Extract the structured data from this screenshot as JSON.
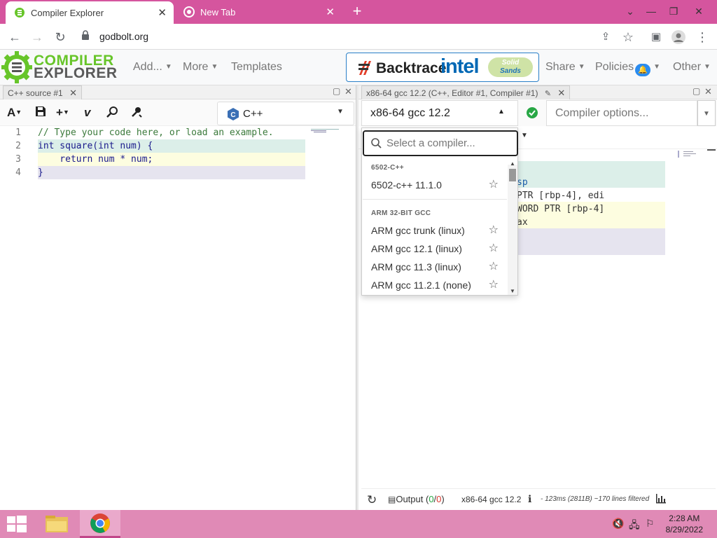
{
  "browser": {
    "tabs": [
      {
        "label": "Compiler Explorer",
        "icon": "compiler-explorer-favicon"
      },
      {
        "label": "New Tab",
        "icon": "chrome-icon"
      }
    ],
    "address": "godbolt.org"
  },
  "header": {
    "logo_line1": "COMPILER",
    "logo_line2": "EXPLORER",
    "menus": [
      "Add...",
      "More",
      "Templates"
    ],
    "sponsor": {
      "backtrace": "Backtrace",
      "intel": "intel",
      "solid": "Solid",
      "sands": "Sands"
    },
    "right_menus": [
      "Share",
      "Policies",
      "Other"
    ]
  },
  "editor": {
    "tab_title": "C++ source #1",
    "language": "C++",
    "lines": [
      {
        "n": "1",
        "text": "// Type your code here, or load an example."
      },
      {
        "n": "2",
        "text": "int square(int num) {"
      },
      {
        "n": "3",
        "text": "    return num * num;"
      },
      {
        "n": "4",
        "text": "}"
      }
    ]
  },
  "compiler_pane": {
    "tab_title": "x86-64 gcc 12.2 (C++, Editor #1, Compiler #1)",
    "compiler": "x86-64 gcc 12.2",
    "options_placeholder": "Compiler options...",
    "asm_fragments": [
      "sp",
      "PTR [rbp-4], edi",
      "WORD PTR [rbp-4]",
      "ax"
    ],
    "status": {
      "output_label": "Output (",
      "output_ok": "0",
      "output_sep": "/",
      "output_err": "0",
      "output_close": ")",
      "compiler_name": "x86-64 gcc 12.2",
      "timing": "- 123ms (2811B) ~170 lines filtered"
    }
  },
  "dropdown": {
    "placeholder": "Select a compiler...",
    "groups": [
      {
        "name": "6502-C++",
        "items": [
          "6502-c++ 11.1.0"
        ]
      },
      {
        "name": "ARM 32-BIT GCC",
        "items": [
          "ARM gcc trunk (linux)",
          "ARM gcc 12.1 (linux)",
          "ARM gcc 11.3 (linux)",
          "ARM gcc 11.2.1 (none)"
        ]
      }
    ]
  },
  "taskbar": {
    "time": "2:28 AM",
    "date": "8/29/2022"
  },
  "colors": {
    "tabstrip": "#d5559e",
    "taskbar": "#e08ab6",
    "highlight_green": "#dcefe9",
    "highlight_yellow": "#fdfde0",
    "highlight_purple": "#e6e4ef",
    "success": "#28a745"
  }
}
